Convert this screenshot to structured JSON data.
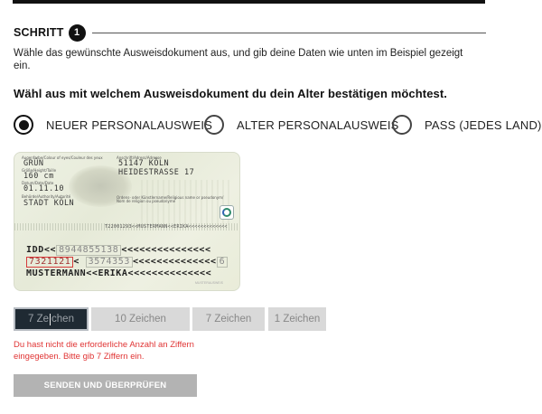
{
  "step": {
    "label": "SCHRITT",
    "number": "1"
  },
  "intro": "Wähle das gewünschte Ausweisdokument aus, und gib deine Daten wie unten im Beispiel gezeigt ein.",
  "question": "Wähl aus mit welchem Ausweisdokument du dein Alter bestätigen möchtest.",
  "document_options": [
    {
      "label": "NEUER PERSONALAUSWEIS",
      "checked": true
    },
    {
      "label": "ALTER PERSONALAUSWEIS",
      "checked": false
    },
    {
      "label": "PASS (JEDES LAND)",
      "checked": false
    }
  ],
  "card": {
    "eye_color_label": "Augenfarbe/Colour of eyes/Couleur des yeux",
    "eye_color": "GRÜN",
    "height_label": "Größe/Height/Taille",
    "height": "160 cm",
    "date_label": "Datum/Date/Date",
    "date": "01.11.10",
    "authority_label": "Behörde/Authority/Autorité",
    "authority": "STADT KÖLN",
    "address_label": "Anschrift/Adress/Adresse",
    "address_line1": "51147 KÖLN",
    "address_line2": "HEIDESTRASSE 17",
    "religious_label_1": "Ordens- oder Künstlername/Religious name or pseudonym/",
    "religious_label_2": "Nom de religion ou pseudonyme",
    "stripe_text": "T22001293<<MUSTERMANN<<ERIKA<<<<<<<<<<<<<",
    "mrz1_prefix": "IDD<<",
    "mrz1_box": "8944855138",
    "mrz1_suffix": "<<<<<<<<<<<<<<<",
    "mrz2_box_red": "7321121",
    "mrz2_mid": "<",
    "mrz2_box": "3574353",
    "mrz2_suffix": "<<<<<<<<<<<<<<",
    "mrz2_end_box": "6",
    "mrz3": "MUSTERMANN<<ERIKA<<<<<<<<<<<<<<",
    "bottom_tiny": "MUSTERAUSWEIS"
  },
  "fields": [
    {
      "placeholder_left": "7 Ze",
      "placeholder_right": "chen",
      "active": true
    },
    {
      "placeholder": "10 Zeichen"
    },
    {
      "placeholder": "7 Zeichen"
    },
    {
      "placeholder": "1 Zeichen"
    }
  ],
  "error": "Du hast nicht die erforderliche Anzahl an Ziffern eingegeben. Bitte gib 7 Ziffern ein.",
  "submit_label": "SENDEN UND ÜBERPRÜFEN",
  "colors": {
    "error": "#e03434",
    "active_field_bg": "#1f2a33",
    "field_bg": "#d9d9d9",
    "button_bg": "#b3b3b3"
  }
}
